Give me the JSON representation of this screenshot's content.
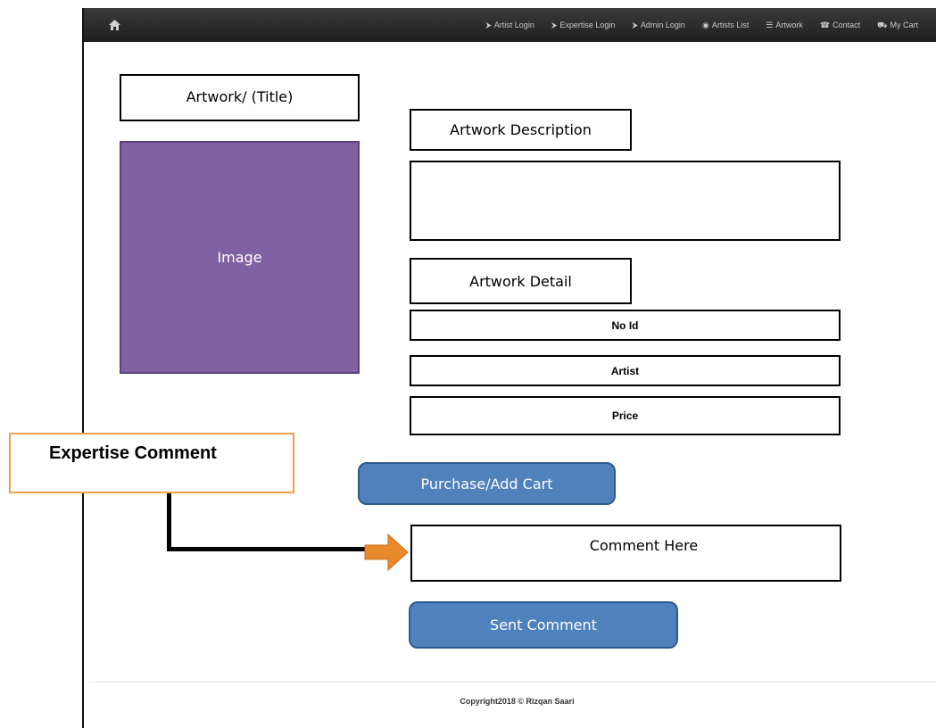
{
  "nav": {
    "home_icon": "home-icon",
    "items": [
      {
        "label": "Artist Login",
        "icon": "sign-in-icon",
        "glyph": "⮞"
      },
      {
        "label": "Expertise Login",
        "icon": "sign-in-icon",
        "glyph": "⮞"
      },
      {
        "label": "Admin Login",
        "icon": "sign-in-icon",
        "glyph": "⮞"
      },
      {
        "label": "Artists List",
        "icon": "globe-icon",
        "glyph": "◉"
      },
      {
        "label": "Artwork",
        "icon": "list-icon",
        "glyph": "☰"
      },
      {
        "label": "Contact",
        "icon": "phone-icon",
        "glyph": "☎"
      },
      {
        "label": "My Cart",
        "icon": "cart-icon",
        "glyph": "⛟"
      }
    ]
  },
  "artwork": {
    "title": "Artwork/ (Title)",
    "image_label": "Image",
    "description_label": "Artwork Description",
    "description_text": "",
    "detail_label": "Artwork Detail",
    "details": [
      "No Id",
      "Artist",
      "Price"
    ]
  },
  "actions": {
    "purchase_label": "Purchase/Add Cart",
    "comment_placeholder": "Comment Here",
    "send_label": "Sent Comment"
  },
  "annotation": {
    "callout_text": "Expertise Comment",
    "callout_border_color": "#f2a14a",
    "arrow_color": "#e8892c"
  },
  "footer": {
    "copyright": "Copyright2018 © Rizqan Saari"
  }
}
